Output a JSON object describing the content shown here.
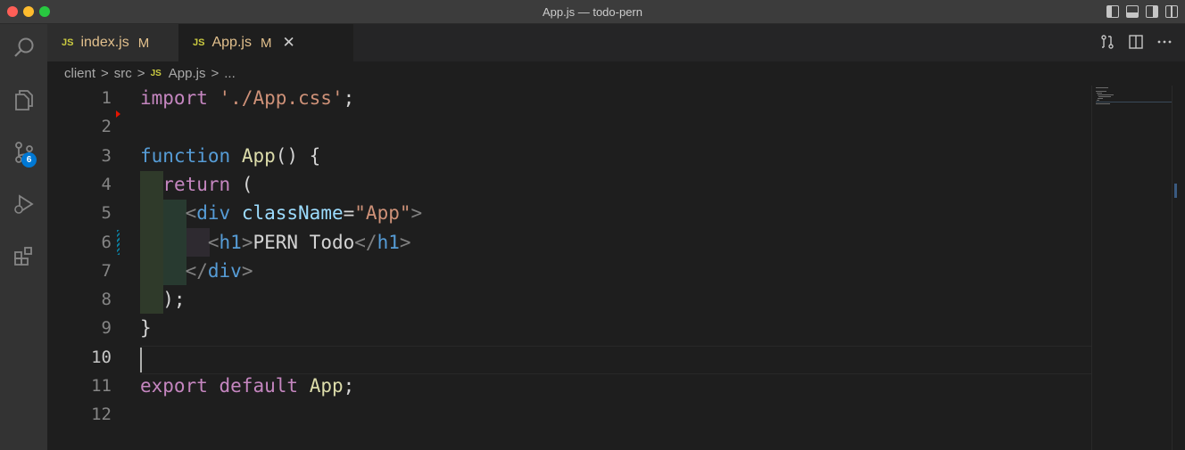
{
  "window": {
    "title": "App.js — todo-pern"
  },
  "activity_bar": {
    "items": [
      {
        "name": "explorer-search",
        "icon": "search-icon"
      },
      {
        "name": "explorer",
        "icon": "files-icon"
      },
      {
        "name": "source-control",
        "icon": "source-control-icon",
        "badge": "6"
      },
      {
        "name": "run-debug",
        "icon": "run-debug-icon"
      },
      {
        "name": "extensions",
        "icon": "extensions-icon"
      }
    ]
  },
  "tabs": [
    {
      "icon_text": "JS",
      "label": "index.js",
      "status": "M",
      "active": false
    },
    {
      "icon_text": "JS",
      "label": "App.js",
      "status": "M",
      "active": true,
      "close": "✕"
    }
  ],
  "breadcrumb": {
    "items": [
      "client",
      "src",
      "App.js",
      "..."
    ],
    "separator": ">",
    "file_icon_text": "JS"
  },
  "editor": {
    "current_line": 10,
    "lines": [
      {
        "n": "1",
        "tokens": [
          [
            "kw",
            "import"
          ],
          [
            "plain",
            " "
          ],
          [
            "str",
            "'./App.css'"
          ],
          [
            "plain",
            ";"
          ]
        ]
      },
      {
        "n": "2",
        "tokens": []
      },
      {
        "n": "3",
        "tokens": [
          [
            "kw2",
            "function"
          ],
          [
            "plain",
            " "
          ],
          [
            "fn",
            "App"
          ],
          [
            "plain",
            "() {"
          ]
        ]
      },
      {
        "n": "4",
        "tokens": [
          [
            "plain",
            "  "
          ],
          [
            "kw",
            "return"
          ],
          [
            "plain",
            " ("
          ]
        ]
      },
      {
        "n": "5",
        "tokens": [
          [
            "plain",
            "    "
          ],
          [
            "punct",
            "<"
          ],
          [
            "tag",
            "div"
          ],
          [
            "plain",
            " "
          ],
          [
            "attr",
            "className"
          ],
          [
            "plain",
            "="
          ],
          [
            "str",
            "\"App\""
          ],
          [
            "punct",
            ">"
          ]
        ]
      },
      {
        "n": "6",
        "tokens": [
          [
            "plain",
            "      "
          ],
          [
            "punct",
            "<"
          ],
          [
            "tag",
            "h1"
          ],
          [
            "punct",
            ">"
          ],
          [
            "plain",
            "PERN Todo"
          ],
          [
            "punct",
            "</"
          ],
          [
            "tag",
            "h1"
          ],
          [
            "punct",
            ">"
          ]
        ]
      },
      {
        "n": "7",
        "tokens": [
          [
            "plain",
            "    "
          ],
          [
            "punct",
            "</"
          ],
          [
            "tag",
            "div"
          ],
          [
            "punct",
            ">"
          ]
        ]
      },
      {
        "n": "8",
        "tokens": [
          [
            "plain",
            "  );"
          ]
        ]
      },
      {
        "n": "9",
        "tokens": [
          [
            "plain",
            "}"
          ]
        ]
      },
      {
        "n": "10",
        "tokens": []
      },
      {
        "n": "11",
        "tokens": [
          [
            "kw",
            "export"
          ],
          [
            "plain",
            " "
          ],
          [
            "kw",
            "default"
          ],
          [
            "plain",
            " "
          ],
          [
            "fn",
            "App"
          ],
          [
            "plain",
            ";"
          ]
        ]
      },
      {
        "n": "12",
        "tokens": []
      }
    ]
  },
  "colors": {
    "keyword": "#c586c0",
    "storage": "#569cd6",
    "function": "#dcdcaa",
    "string": "#ce9178",
    "attribute": "#9cdcfe",
    "modified": "#e2c08d",
    "badge": "#0078d4"
  }
}
